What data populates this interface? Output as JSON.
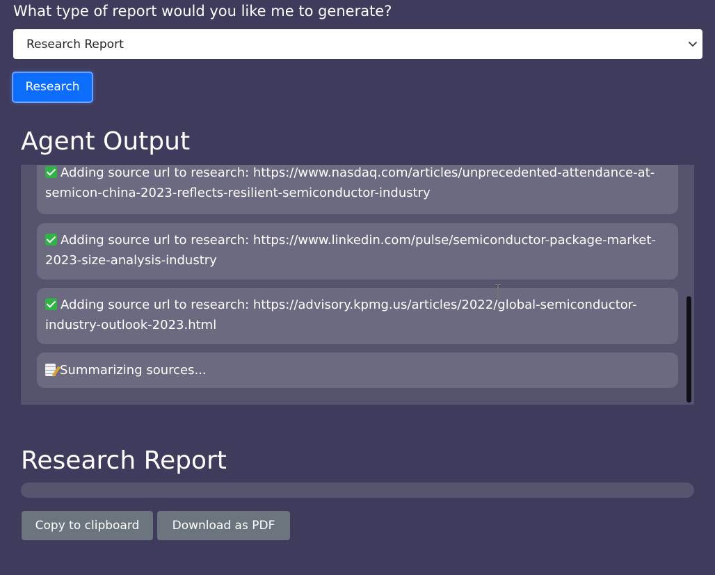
{
  "form": {
    "question": "What type of report would you like me to generate?",
    "report_type_selected": "Research Report",
    "research_button_label": "Research"
  },
  "agent_output": {
    "heading": "Agent Output",
    "logs": [
      {
        "icon": "check-mark-icon",
        "text": "Adding source url to research: https://www.nasdaq.com/articles/unprecedented-attendance-at-semicon-china-2023-reflects-resilient-semiconductor-industry"
      },
      {
        "icon": "check-mark-icon",
        "text": "Adding source url to research: https://www.linkedin.com/pulse/semiconductor-package-market-2023-size-analysis-industry"
      },
      {
        "icon": "check-mark-icon",
        "text": "Adding source url to research: https://advisory.kpmg.us/articles/2022/global-semiconductor-industry-outlook-2023.html"
      },
      {
        "icon": "memo-icon",
        "text": "Summarizing sources..."
      }
    ]
  },
  "report": {
    "heading": "Research Report",
    "copy_button_label": "Copy to clipboard",
    "download_button_label": "Download as PDF"
  },
  "colors": {
    "background": "#3f3b5c",
    "primary_button": "#0d6efd",
    "secondary_button": "#6c757d",
    "log_item": "#6c6a80"
  }
}
